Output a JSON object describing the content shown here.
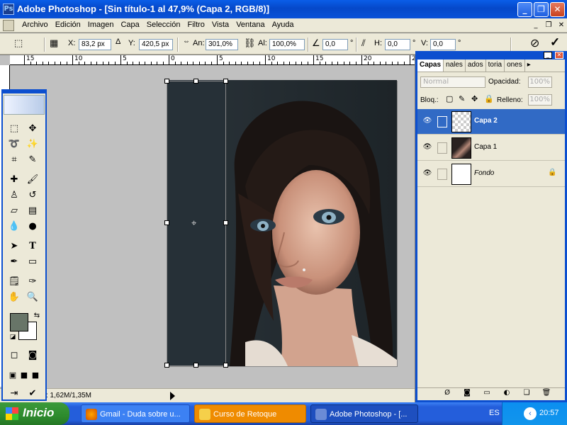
{
  "window": {
    "title": "Adobe Photoshop - [Sin título-1 al 47,9% (Capa 2, RGB/8)]",
    "min_icon": "minimize-icon",
    "max_icon": "restore-icon",
    "close_icon": "close-icon"
  },
  "menu": [
    "Archivo",
    "Edición",
    "Imagen",
    "Capa",
    "Selección",
    "Filtro",
    "Vista",
    "Ventana",
    "Ayuda"
  ],
  "options": {
    "x_label": "X:",
    "x_value": "83,2 px",
    "y_label": "Y:",
    "y_value": "420,5 px",
    "w_label": "An:",
    "w_value": "301,0%",
    "h_label": "Al:",
    "h_value": "100,0%",
    "angle_value": "0,0",
    "angle_unit": "°",
    "hskew_label": "H:",
    "hskew_value": "0,0",
    "vskew_label": "V:",
    "vskew_value": "0,0",
    "cancel_icon": "cancel-transform-icon",
    "commit_icon": "commit-transform-icon"
  },
  "ruler": {
    "ticks": [
      "15",
      "10",
      "5",
      "0",
      "5",
      "10",
      "15",
      "20",
      "25"
    ]
  },
  "status": {
    "text": "c: 1,62M/1,35M"
  },
  "layers_panel": {
    "tabs": [
      "Capas",
      "nales",
      "ados",
      "toria",
      "ones"
    ],
    "blend_mode": "Normal",
    "opacity_label": "Opacidad:",
    "opacity_value": "100%",
    "lock_label": "Bloq.:",
    "fill_label": "Relleno:",
    "fill_value": "100%",
    "layers": [
      {
        "name": "Capa 2",
        "selected": true
      },
      {
        "name": "Capa 1",
        "selected": false
      },
      {
        "name": "Fondo",
        "selected": false,
        "locked": true
      }
    ]
  },
  "colors": {
    "foreground": "#687568",
    "background": "#ffffff",
    "selection": "#316ac5"
  },
  "taskbar": {
    "start_label": "Inicio",
    "buttons": [
      {
        "label": "Gmail - Duda sobre u...",
        "icon": "firefox-icon"
      },
      {
        "label": "Curso de Retoque",
        "icon": "folder-icon"
      },
      {
        "label": "Adobe Photoshop - [...",
        "icon": "photoshop-icon"
      }
    ],
    "lang": "ES",
    "clock": "20:57"
  }
}
